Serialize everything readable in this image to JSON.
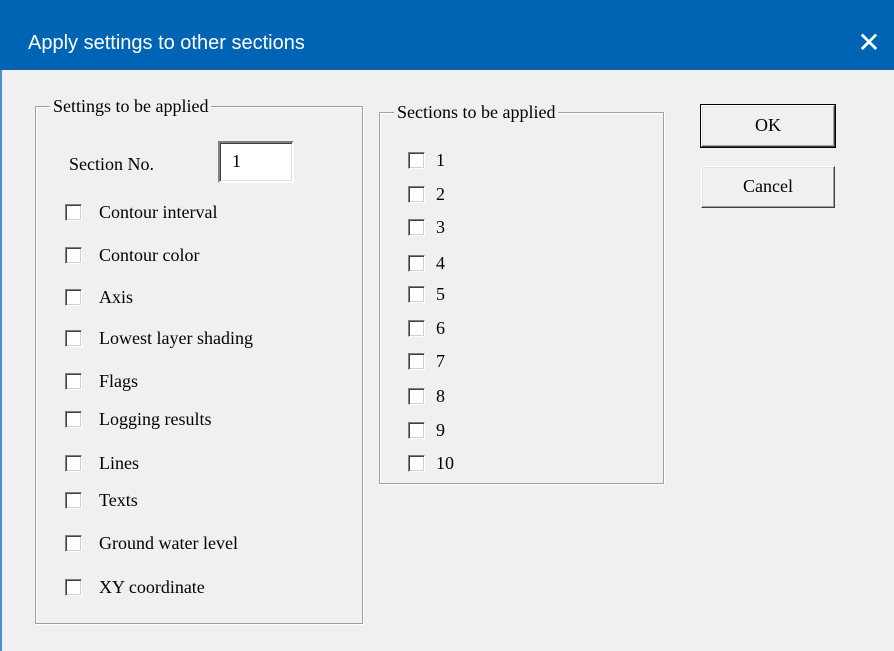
{
  "window": {
    "title": "Apply settings to other sections",
    "close_symbol": "✕"
  },
  "settings_group": {
    "label": "Settings to be applied",
    "section_no_label": "Section No.",
    "section_no_value": "1",
    "items": [
      {
        "label": "Contour interval",
        "checked": false
      },
      {
        "label": "Contour color",
        "checked": false
      },
      {
        "label": "Axis",
        "checked": false
      },
      {
        "label": "Lowest layer shading",
        "checked": false
      },
      {
        "label": "Flags",
        "checked": false
      },
      {
        "label": "Logging results",
        "checked": false
      },
      {
        "label": "Lines",
        "checked": false
      },
      {
        "label": "Texts",
        "checked": false
      },
      {
        "label": "Ground water level",
        "checked": false
      },
      {
        "label": "XY coordinate",
        "checked": false
      }
    ]
  },
  "sections_group": {
    "label": "Sections to be applied",
    "items": [
      {
        "label": "1",
        "checked": false
      },
      {
        "label": "2",
        "checked": false
      },
      {
        "label": "3",
        "checked": false
      },
      {
        "label": "4",
        "checked": false
      },
      {
        "label": "5",
        "checked": false
      },
      {
        "label": "6",
        "checked": false
      },
      {
        "label": "7",
        "checked": false
      },
      {
        "label": "8",
        "checked": false
      },
      {
        "label": "9",
        "checked": false
      },
      {
        "label": "10",
        "checked": false
      }
    ]
  },
  "buttons": {
    "ok_label": "OK",
    "cancel_label": "Cancel"
  },
  "colors": {
    "titlebar": "#0064b4",
    "dialog_bg": "#f0f0f0"
  }
}
